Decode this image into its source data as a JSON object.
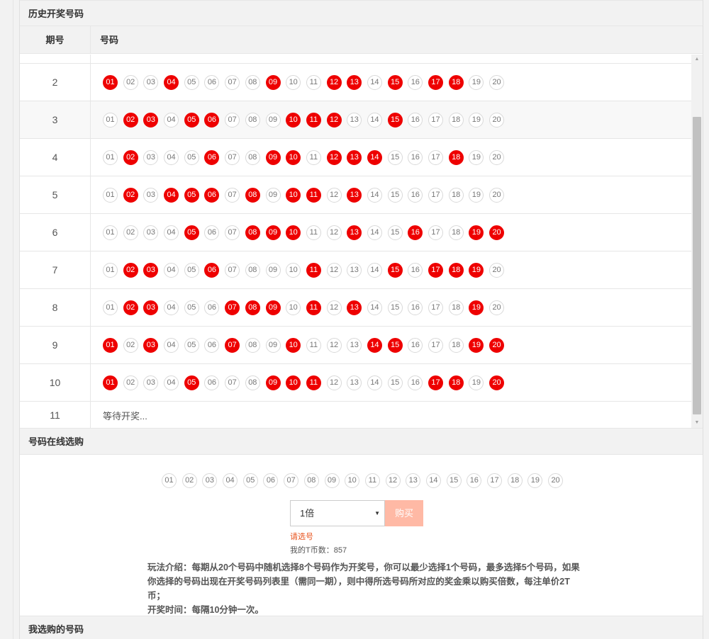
{
  "history": {
    "title": "历史开奖号码",
    "col_period": "期号",
    "col_numbers": "号码",
    "numbers": [
      "01",
      "02",
      "03",
      "04",
      "05",
      "06",
      "07",
      "08",
      "09",
      "10",
      "11",
      "12",
      "13",
      "14",
      "15",
      "16",
      "17",
      "18",
      "19",
      "20"
    ],
    "rows": [
      {
        "period": "2",
        "hits": [
          "01",
          "04",
          "09",
          "12",
          "13",
          "15",
          "17",
          "18"
        ]
      },
      {
        "period": "3",
        "hits": [
          "02",
          "03",
          "05",
          "06",
          "10",
          "11",
          "12",
          "15"
        ]
      },
      {
        "period": "4",
        "hits": [
          "02",
          "06",
          "09",
          "10",
          "12",
          "13",
          "14",
          "18"
        ]
      },
      {
        "period": "5",
        "hits": [
          "02",
          "04",
          "05",
          "06",
          "08",
          "10",
          "11",
          "13"
        ]
      },
      {
        "period": "6",
        "hits": [
          "05",
          "08",
          "09",
          "10",
          "13",
          "16",
          "19",
          "20"
        ]
      },
      {
        "period": "7",
        "hits": [
          "02",
          "03",
          "06",
          "11",
          "15",
          "17",
          "18",
          "19"
        ]
      },
      {
        "period": "8",
        "hits": [
          "02",
          "03",
          "07",
          "08",
          "09",
          "11",
          "13",
          "19"
        ]
      },
      {
        "period": "9",
        "hits": [
          "01",
          "03",
          "07",
          "10",
          "14",
          "15",
          "19",
          "20"
        ]
      },
      {
        "period": "10",
        "hits": [
          "01",
          "05",
          "09",
          "10",
          "11",
          "17",
          "18",
          "20"
        ]
      }
    ],
    "pending": {
      "period": "11",
      "text": "等待开奖..."
    }
  },
  "buy": {
    "title": "号码在线选购",
    "multiplier": "1倍",
    "buy_label": "购买",
    "hint": "请选号",
    "balance": "我的T币数：857",
    "rules_1": "玩法介绍：每期从20个号码中随机选择8个号码作为开奖号，你可以最少选择1个号码，最多选择5个号码，如果你选择的号码出现在开奖号码列表里（需同一期），则中得所选号码所对应的奖金乘以购买倍数，每注单价2T币；",
    "rules_2": "开奖时间：每隔10分钟一次。"
  },
  "my_numbers": {
    "title": "我选购的号码"
  },
  "colors": {
    "hit_ball": "#ee0000",
    "buy_button": "#ffb9a5",
    "hint_text": "#e8541e"
  }
}
